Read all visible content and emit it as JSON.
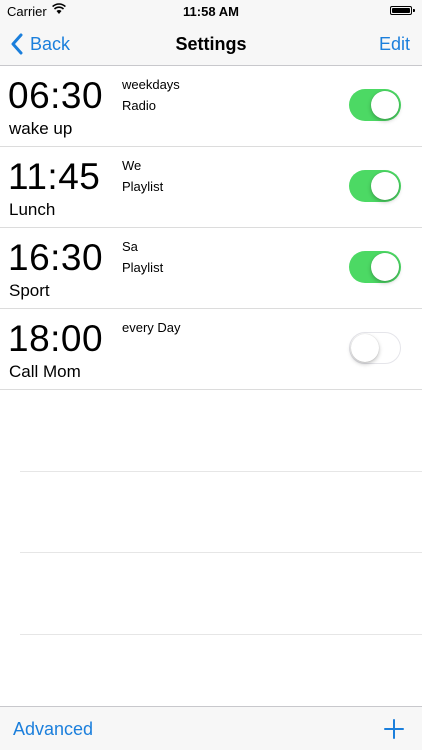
{
  "status_bar": {
    "carrier": "Carrier",
    "time": "11:58 AM"
  },
  "nav": {
    "back_label": "Back",
    "title": "Settings",
    "edit_label": "Edit"
  },
  "alarms": [
    {
      "time": "06:30",
      "label": "wake up",
      "days": "weekdays",
      "sound": "Radio",
      "enabled": true
    },
    {
      "time": "11:45",
      "label": "Lunch",
      "days": "We",
      "sound": "Playlist",
      "enabled": true
    },
    {
      "time": "16:30",
      "label": "Sport",
      "days": "Sa",
      "sound": "Playlist",
      "enabled": true
    },
    {
      "time": "18:00",
      "label": "Call Mom",
      "days": "every Day",
      "sound": "",
      "enabled": false
    }
  ],
  "toolbar": {
    "advanced_label": "Advanced",
    "add_icon": "plus-icon"
  },
  "colors": {
    "accent": "#1b7fdc",
    "toggle_on": "#4cd964"
  }
}
